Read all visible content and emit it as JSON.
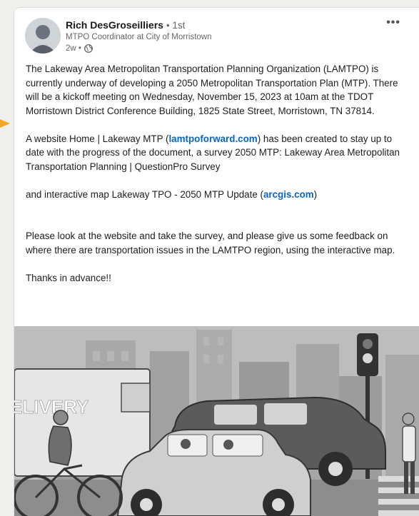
{
  "post": {
    "author": {
      "name": "Rich DesGroseilliers",
      "degree": "• 1st",
      "headline": "MTPO Coordinator at City of Morristown",
      "time": "2w •",
      "visibility_icon": "globe-icon"
    },
    "menu_icon": "more-icon",
    "menu_label": "•••",
    "paragraphs": {
      "p1": "The Lakeway Area Metropolitan Transportation Planning Organization (LAMTPO) is currently underway of developing a 2050 Metropolitan Transportation Plan (MTP). There will be a kickoff meeting on Wednesday, November 15, 2023 at 10am at the TDOT Morristown District Conference Building, 1825 State Street, Morristown, TN 37814.",
      "p2_before": "A website Home | Lakeway MTP (",
      "p2_link": "lamtpoforward.com",
      "p2_after": ") has been created to stay up to date with the progress of the document, a survey 2050 MTP: Lakeway Area Metropolitan Transportation Planning | QuestionPro Survey",
      "p3_before": "and interactive map Lakeway TPO - 2050 MTP Update (",
      "p3_link": "arcgis.com",
      "p3_after": ")",
      "p4": "Please look at the website and take the survey, and please give us some feedback on where there are transportation issues in the LAMTPO region, using the interactive map.",
      "p5": "Thanks in advance!!"
    },
    "image": {
      "truck_text": "ELIVERY"
    }
  },
  "colors": {
    "link": "#0a66c2",
    "arrow": "#f5a623",
    "page_bg": "#f0efeb"
  }
}
